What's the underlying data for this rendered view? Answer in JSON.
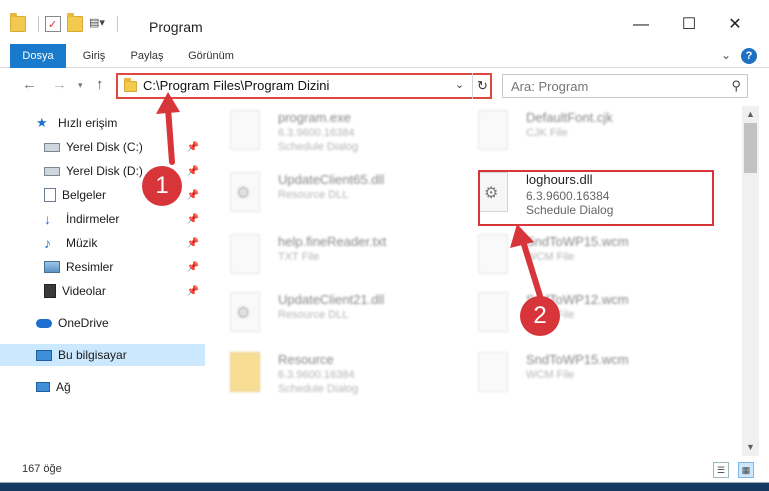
{
  "titlebar": {
    "title": "Program",
    "quick_access": [
      "folder-icon",
      "properties-icon",
      "new-folder-icon",
      "customize-icon"
    ],
    "controls": {
      "minimize": "—",
      "maximize": "☐",
      "close": "✕"
    }
  },
  "ribbon": {
    "tabs": [
      {
        "label": "Dosya",
        "active": true
      },
      {
        "label": "Giriş",
        "active": false
      },
      {
        "label": "Paylaş",
        "active": false
      },
      {
        "label": "Görünüm",
        "active": false
      }
    ],
    "help": "?"
  },
  "address": {
    "path": "C:\\Program Files\\Program Dizini",
    "dropdown": "⌄",
    "refresh": "↻"
  },
  "search": {
    "placeholder": "Ara: Program"
  },
  "sidebar": {
    "items": [
      {
        "label": "Hızlı erişim",
        "icon": "star-icon",
        "pinned": false
      },
      {
        "label": "Yerel Disk (C:)",
        "icon": "drive-icon",
        "pinned": true
      },
      {
        "label": "Yerel Disk (D:)",
        "icon": "drive-icon",
        "pinned": true
      },
      {
        "label": "Belgeler",
        "icon": "documents-icon",
        "pinned": true
      },
      {
        "label": "İndirmeler",
        "icon": "download-icon",
        "pinned": true
      },
      {
        "label": "Müzik",
        "icon": "music-icon",
        "pinned": true
      },
      {
        "label": "Resimler",
        "icon": "pictures-icon",
        "pinned": true
      },
      {
        "label": "Videolar",
        "icon": "videos-icon",
        "pinned": true
      },
      {
        "label": "OneDrive",
        "icon": "cloud-icon",
        "pinned": false
      },
      {
        "label": "Bu bilgisayar",
        "icon": "computer-icon",
        "pinned": false,
        "selected": true
      },
      {
        "label": "Ağ",
        "icon": "network-icon",
        "pinned": false
      }
    ]
  },
  "files": [
    {
      "name": "program.exe",
      "line2": "6.3.9600.16384",
      "line3": "Schedule Dialog",
      "blurred": true
    },
    {
      "name": "DefaultFont.cjk",
      "line2": "CJK File",
      "line3": "",
      "blurred": true
    },
    {
      "name": "UpdateClient65.dll",
      "line2": "Resource DLL",
      "line3": "",
      "blurred": true
    },
    {
      "name": "loghours.dll",
      "line2": "6.3.9600.16384",
      "line3": "Schedule Dialog",
      "blurred": false,
      "highlighted": true
    },
    {
      "name": "help.fineReader.txt",
      "line2": "TXT File",
      "line3": "",
      "blurred": true
    },
    {
      "name": "SndToWP15.wcm",
      "line2": "WCM File",
      "line3": "",
      "blurred": true
    },
    {
      "name": "UpdateClient21.dll",
      "line2": "Resource DLL",
      "line3": "",
      "blurred": true
    },
    {
      "name": "SndToWP12.wcm",
      "line2": "WCM File",
      "line3": "",
      "blurred": true
    },
    {
      "name": "Resource",
      "line2": "6.3.9600.16384",
      "line3": "Schedule Dialog",
      "blurred": true
    },
    {
      "name": "SndToWP15.wcm",
      "line2": "WCM File",
      "line3": "",
      "blurred": true
    }
  ],
  "status": {
    "count": "167 öğe"
  },
  "annotations": {
    "step1": "1",
    "step2": "2",
    "color": "#d8353b"
  }
}
